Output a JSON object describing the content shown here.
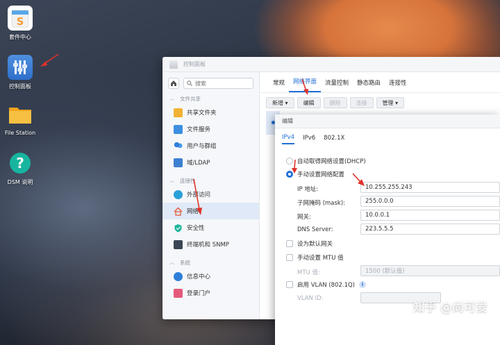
{
  "desktop": {
    "icons": [
      {
        "label": "套件中心"
      },
      {
        "label": "控制面板"
      },
      {
        "label": "File Station"
      },
      {
        "label": "DSM 说明"
      }
    ]
  },
  "control_panel": {
    "title": "控制面板",
    "search_placeholder": "搜索",
    "sidebar": {
      "sections": [
        {
          "label": "文件共享"
        },
        {
          "label": "连接性"
        },
        {
          "label": "系统"
        }
      ],
      "items": [
        {
          "label": "共享文件夹"
        },
        {
          "label": "文件服务"
        },
        {
          "label": "用户与群组"
        },
        {
          "label": "域/LDAP"
        },
        {
          "label": "外部访问"
        },
        {
          "label": "网络"
        },
        {
          "label": "安全性"
        },
        {
          "label": "终端机和 SNMP"
        },
        {
          "label": "信息中心"
        },
        {
          "label": "登录门户"
        }
      ]
    },
    "tabs": [
      {
        "label": "常规"
      },
      {
        "label": "网络界面"
      },
      {
        "label": "流量控制"
      },
      {
        "label": "静态路由"
      },
      {
        "label": "连接性"
      }
    ],
    "toolbar": {
      "create": "新增 ▾",
      "edit": "编辑",
      "delete": "删除",
      "connect": "连接",
      "manage": "管理 ▾"
    }
  },
  "edit_dialog": {
    "title": "编辑",
    "tabs": [
      {
        "label": "IPv4"
      },
      {
        "label": "IPv6"
      },
      {
        "label": "802.1X"
      }
    ],
    "auto_dhcp": "自动取得网络设置(DHCP)",
    "manual": "手动设置网络配置",
    "fields": {
      "ip_label": "IP 地址:",
      "ip_value": "10.255.255.243",
      "mask_label": "子网掩码 (mask):",
      "mask_value": "255.0.0.0",
      "gateway_label": "网关:",
      "gateway_value": "10.0.0.1",
      "dns_label": "DNS Server:",
      "dns_value": "223.5.5.5"
    },
    "default_gateway": "设为默认网关",
    "manual_mtu": "手动设置 MTU 值",
    "mtu_label": "MTU 值:",
    "mtu_value": "1500 (默认值)",
    "enable_vlan": "启用 VLAN (802.1Q)",
    "vlan_id_label": "VLAN ID:"
  },
  "watermark": "知乎 @尚可爱",
  "colors": {
    "accent": "#1f6fd6",
    "annotation_arrow": "#e0322b"
  }
}
